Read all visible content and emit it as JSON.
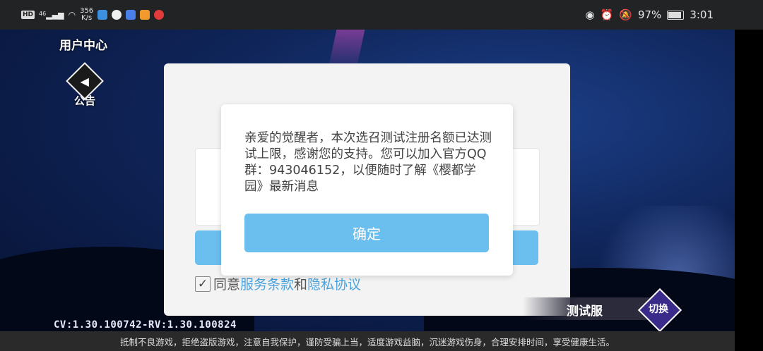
{
  "status_bar": {
    "left_badge": "HD",
    "signal_label": "46",
    "net_speed_value": "356",
    "net_speed_unit": "K/s",
    "battery_percent": "97%",
    "time": "3:01",
    "app_icon_colors": [
      "#3d8fe0",
      "#f0f0f0",
      "#4a7ee8",
      "#f29a2e",
      "#e23b3b"
    ]
  },
  "game": {
    "user_center_label": "用户中心",
    "notice_label": "公告",
    "server_name": "测试服",
    "switch_label": "切换",
    "version": "CV:1.30.100742-RV:1.30.100824",
    "footer_notice": "抵制不良游戏，拒绝盗版游戏，注意自我保护，谨防受骗上当，适度游戏益脑，沉迷游戏伤身，合理安排时间，享受健康生活。"
  },
  "login": {
    "agree_prefix": "同意",
    "terms_link": "服务条款",
    "conjunction": "和",
    "privacy_link": "隐私协议",
    "agree_checked": true
  },
  "dialog": {
    "message": "亲爱的觉醒者，本次选召测试注册名额已达测试上限，感谢您的支持。您可以加入官方QQ群：943046152，以便随时了解《樱都学园》最新消息",
    "confirm_label": "确定"
  },
  "colors": {
    "accent": "#6bbfee",
    "link": "#4aa3dd"
  }
}
